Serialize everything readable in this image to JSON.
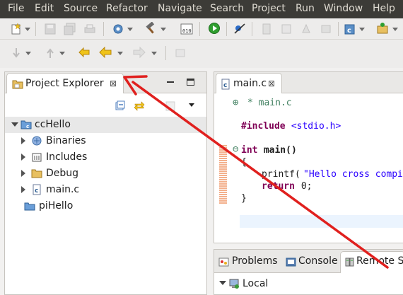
{
  "menu": [
    "File",
    "Edit",
    "Source",
    "Refactor",
    "Navigate",
    "Search",
    "Project",
    "Run",
    "Window",
    "Help"
  ],
  "project_explorer": {
    "title": "Project Explorer",
    "close_glyph": "⊠",
    "tree": [
      {
        "label": "ccHello",
        "icon": "c-project-folder-icon",
        "expanded": true
      },
      {
        "label": "Binaries",
        "icon": "binaries-icon"
      },
      {
        "label": "Includes",
        "icon": "includes-icon"
      },
      {
        "label": "Debug",
        "icon": "folder-icon"
      },
      {
        "label": "main.c",
        "icon": "c-file-icon"
      },
      {
        "label": "piHello",
        "icon": "closed-project-icon"
      }
    ]
  },
  "editor": {
    "tab_label": "main.c",
    "close_glyph": "⊠",
    "lines": {
      "l1": "* main.c",
      "l2a": "#include",
      "l2b": " <stdio.h>",
      "l3a": "int",
      "l3b": " main()",
      "l4": "{",
      "l5a": "printf(",
      "l5b": "\"Hello cross compi",
      "l6a": "return",
      "l6b": " 0;",
      "l7": "}"
    }
  },
  "bottom_panel": {
    "tabs": [
      "Problems",
      "Console",
      "Remote Sy"
    ],
    "tree_root": "Local"
  },
  "colors": {
    "annotation_arrow": "#e0201e",
    "menubar_bg": "#3c3b37"
  }
}
